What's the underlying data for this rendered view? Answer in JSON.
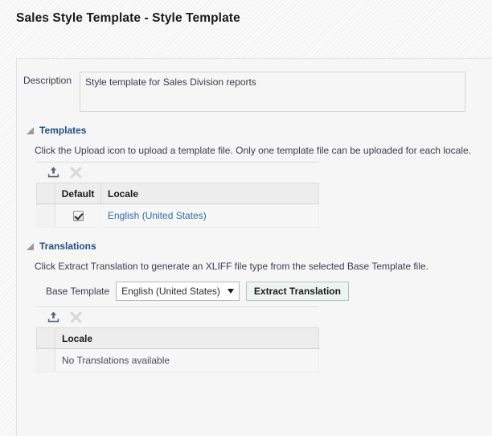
{
  "header": {
    "title": "Sales Style Template - Style Template"
  },
  "description": {
    "label": "Description",
    "value": "Style template for Sales Division reports",
    "placeholder": ""
  },
  "templates_section": {
    "title": "Templates",
    "expanded": true,
    "instruction": "Click the Upload icon to upload a template file. Only one template file can be uploaded for each locale.",
    "toolbar": {
      "upload_icon": "upload-icon",
      "delete_icon": "delete-icon",
      "delete_disabled": true
    },
    "table": {
      "columns": [
        "",
        "Default",
        "Locale"
      ],
      "rows": [
        {
          "default_checked": true,
          "locale": "English (United States)"
        }
      ]
    }
  },
  "translations_section": {
    "title": "Translations",
    "expanded": true,
    "instruction": "Click Extract Translation to generate an XLIFF file type from the selected Base Template file.",
    "base_template": {
      "label": "Base Template",
      "selected": "English (United States)",
      "options": [
        "English (United States)"
      ]
    },
    "extract_button": "Extract Translation",
    "toolbar": {
      "upload_icon": "upload-icon",
      "delete_icon": "delete-icon",
      "delete_disabled": true
    },
    "table": {
      "columns": [
        "",
        "Locale"
      ],
      "empty_message": "No Translations available"
    }
  },
  "colors": {
    "section_title": "#1f4f82",
    "link": "#2c6ca8",
    "button_face": "#eef4f2",
    "icon_active": "#5b6279",
    "icon_disabled": "#d8d8d8"
  }
}
